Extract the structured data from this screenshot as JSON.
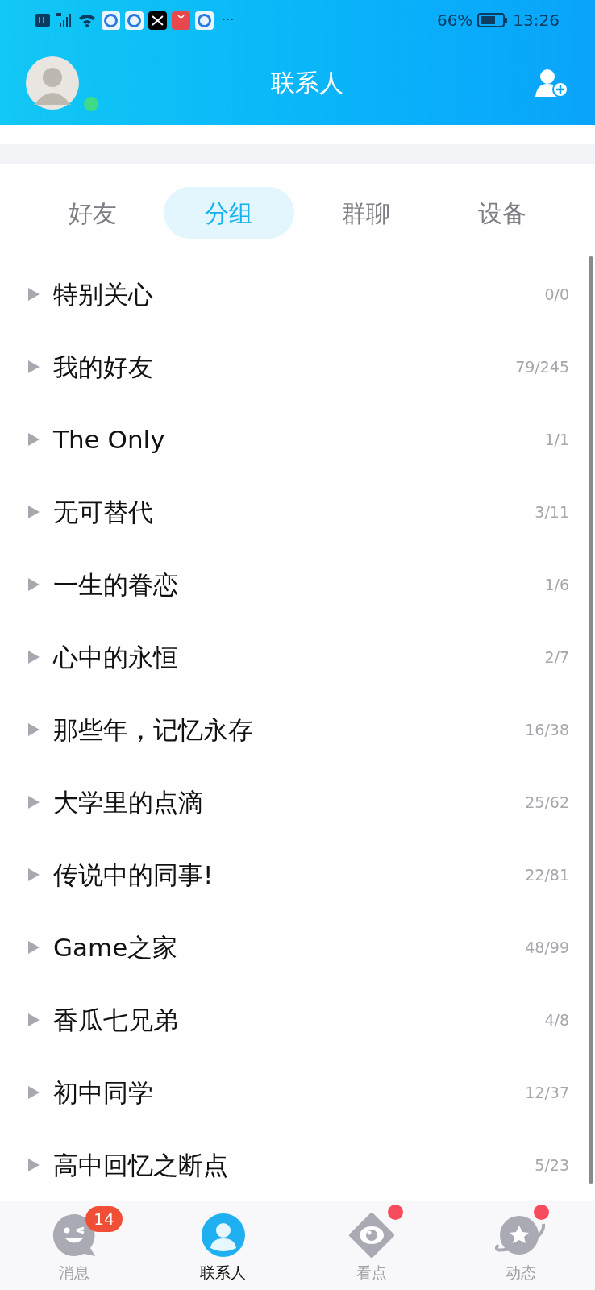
{
  "status_bar": {
    "battery_percent": "66%",
    "time": "13:26",
    "more": "···"
  },
  "header": {
    "title": "联系人",
    "online": true
  },
  "tabs": [
    {
      "label": "好友",
      "selected": false
    },
    {
      "label": "分组",
      "selected": true
    },
    {
      "label": "群聊",
      "selected": false
    },
    {
      "label": "设备",
      "selected": false
    }
  ],
  "groups": [
    {
      "name": "特别关心",
      "count": "0/0"
    },
    {
      "name": "我的好友",
      "count": "79/245"
    },
    {
      "name": "The Only",
      "count": "1/1"
    },
    {
      "name": "无可替代",
      "count": "3/11"
    },
    {
      "name": "一生的眷恋",
      "count": "1/6"
    },
    {
      "name": "心中的永恒",
      "count": "2/7"
    },
    {
      "name": "那些年，记忆永存",
      "count": "16/38"
    },
    {
      "name": "大学里的点滴",
      "count": "25/62"
    },
    {
      "name": "传说中的同事!",
      "count": "22/81"
    },
    {
      "name": "Game之家",
      "count": "48/99"
    },
    {
      "name": "香瓜七兄弟",
      "count": "4/8"
    },
    {
      "name": "初中同学",
      "count": "12/37"
    },
    {
      "name": "高中回忆之断点",
      "count": "5/23"
    }
  ],
  "bottom_nav": [
    {
      "kind": "chat",
      "label": "消息",
      "selected": false,
      "badge": "14"
    },
    {
      "kind": "contact",
      "label": "联系人",
      "selected": true
    },
    {
      "kind": "eye",
      "label": "看点",
      "selected": false,
      "dot": true
    },
    {
      "kind": "planet",
      "label": "动态",
      "selected": false,
      "dot": true
    }
  ]
}
